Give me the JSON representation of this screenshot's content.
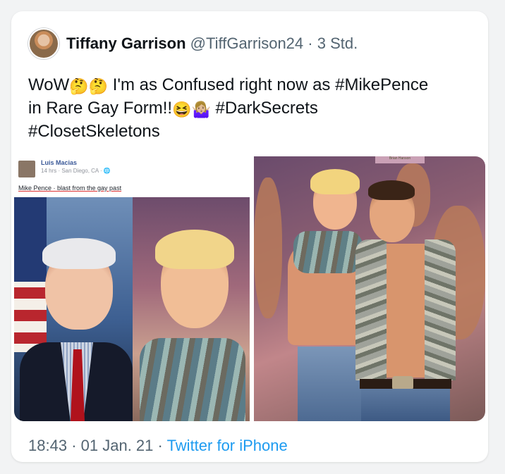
{
  "tweet": {
    "author_name": "Tiffany Garrison",
    "author_handle": "@TiffGarrison24",
    "separator": "·",
    "relative_time": "3 Std.",
    "text_parts": {
      "part1": "WoW",
      "part2": " I'm as Confused right now as ",
      "hashtag1": "#MikePence",
      "part3": " in Rare Gay Form!!",
      "hashtag2": "#DarkSecrets",
      "hashtag3": "#ClosetSkeletons"
    },
    "emoji": {
      "thinking": "🤔",
      "laughing": "😆",
      "shrug": "🤷🏼‍♀️"
    }
  },
  "media": {
    "left_photo": {
      "fb_name": "Luis Macias",
      "fb_meta": "14 hrs · San Diego, CA · 🌐",
      "caption": "Mike Pence · blast from the gay past"
    },
    "right_photo": {
      "sign_text": "Brian Hanson"
    }
  },
  "footer": {
    "time": "18:43",
    "separator": "·",
    "date": "01 Jan. 21",
    "source": "Twitter for iPhone"
  },
  "colors": {
    "link": "#1d9bf0",
    "secondary_text": "#536471",
    "primary_text": "#0f1419"
  }
}
